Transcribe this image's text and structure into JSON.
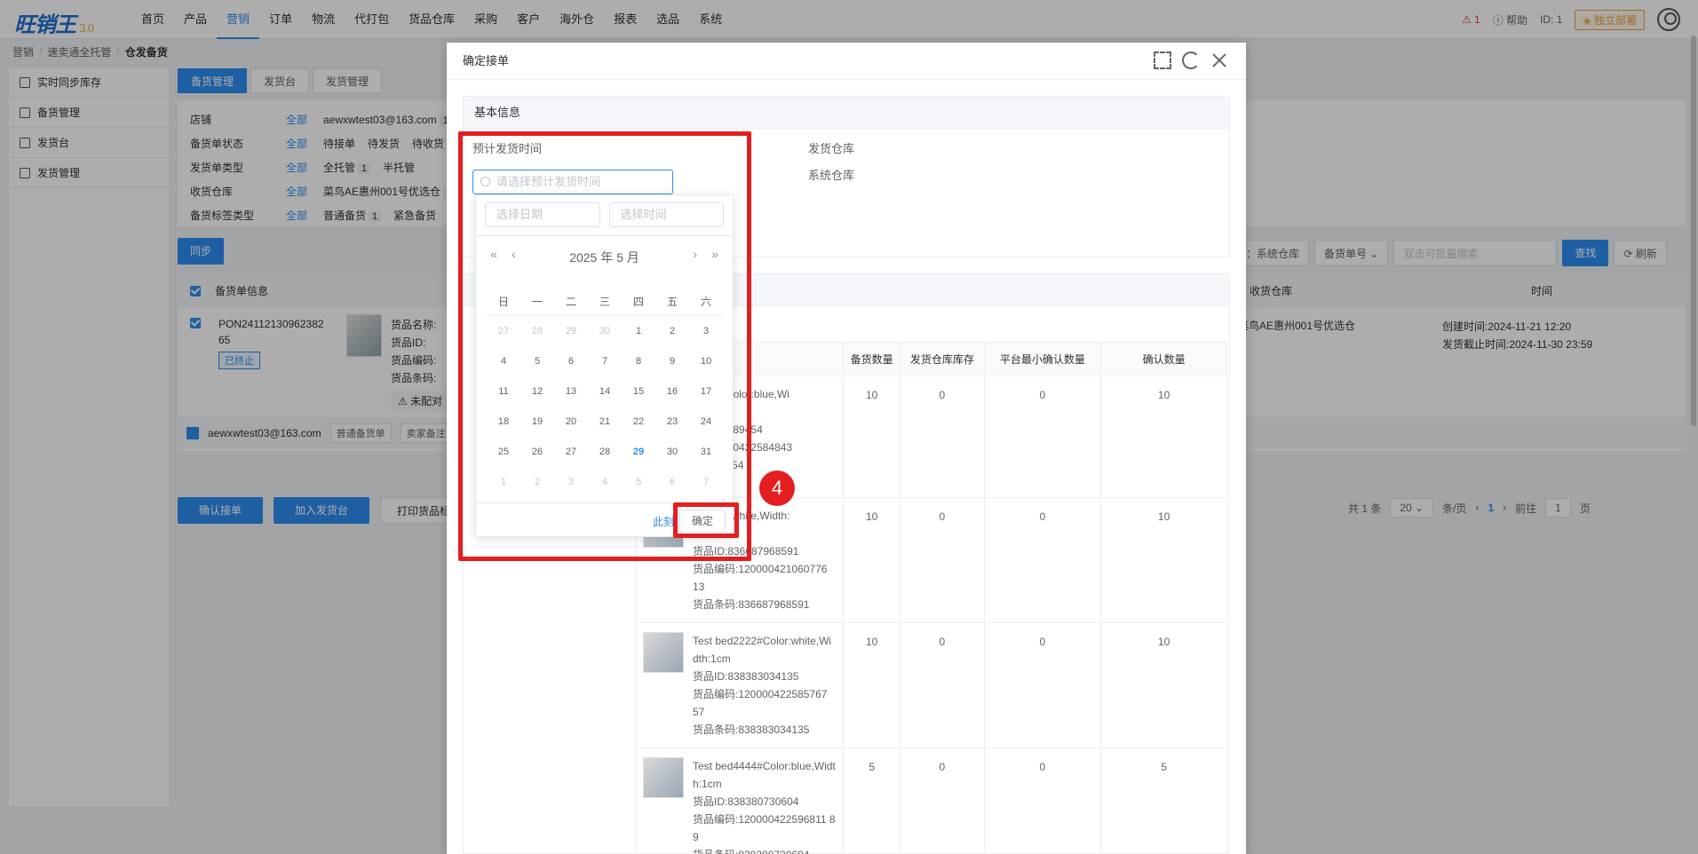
{
  "app": {
    "logo": "旺销王",
    "version": "3.0"
  },
  "topnav": {
    "items": [
      "首页",
      "产品",
      "营销",
      "订单",
      "物流",
      "代打包",
      "货品仓库",
      "采购",
      "客户",
      "海外仓",
      "报表",
      "选品",
      "系统"
    ],
    "active_index": 2,
    "warning_count": "1",
    "help_label": "帮助",
    "user_id": "ID: 1",
    "deploy_label": "独立部署"
  },
  "breadcrumb": [
    "营销",
    "速卖通全托管",
    "仓发备货"
  ],
  "sidebar": {
    "items": [
      "实时同步库存",
      "备货管理",
      "发货台",
      "发货管理"
    ]
  },
  "subtabs": [
    "备货管理",
    "发货台",
    "发货管理"
  ],
  "filters": {
    "rows": [
      {
        "label": "店铺",
        "all": "全部",
        "options": [
          "aewxwtest03@163.com"
        ],
        "counts": [
          "1"
        ]
      },
      {
        "label": "备货单状态",
        "all": "全部",
        "options": [
          "待接单",
          "待发货",
          "待收货"
        ],
        "counts": []
      },
      {
        "label": "发货单类型",
        "all": "全部",
        "options": [
          "全托管",
          "半托管"
        ],
        "counts": [
          "1"
        ]
      },
      {
        "label": "收货仓库",
        "all": "全部",
        "options": [
          "菜鸟AE惠州001号优选仓"
        ],
        "counts": [
          "1"
        ]
      },
      {
        "label": "备货标签类型",
        "all": "全部",
        "options": [
          "普通备货",
          "紧急备货"
        ],
        "counts": [
          "1"
        ]
      }
    ]
  },
  "sync_button": "同步",
  "search_tools": {
    "warehouse_filter": "库：系统仓库",
    "field_select": "备货单号",
    "search_placeholder": "双击可批量搜索",
    "search_button": "查找",
    "refresh_button": "刷新"
  },
  "main_table": {
    "headers": [
      "备货单信息",
      "收货仓库",
      "时间"
    ],
    "row": {
      "order_no": "PON2411213096238265",
      "status": "已终止",
      "goods_labels": [
        "货品名称:",
        "货品ID:",
        "货品编码:",
        "货品条码:"
      ],
      "unmatched": "未配对",
      "warehouse": "菜鸟AE惠州001号优选仓",
      "created": "创建时间:2024-11-21 12:20",
      "deadline": "发货截止时间:2024-11-30 23:59"
    },
    "shop_row": {
      "shop": "aewxwtest03@163.com",
      "tags": [
        "普通备货单",
        "卖家备注"
      ]
    }
  },
  "bottom_actions": [
    "确认接单",
    "加入发货台",
    "打印货品标签"
  ],
  "pager": {
    "total": "共 1 条",
    "page_size": "20",
    "per_page": "条/页",
    "current": "1",
    "goto": "前往",
    "goto_value": "1",
    "page_unit": "页"
  },
  "modal": {
    "title": "确定接单",
    "basic_info_title": "基本信息",
    "est_ship_label": "预计发货时间",
    "date_placeholder": "请选择预计发货时间",
    "ship_wh_label": "发货仓库",
    "sys_wh_label": "系统仓库",
    "goods_headers": [
      "",
      "备货数量",
      "发货仓库库存",
      "平台最小确认数量",
      "确认数量"
    ],
    "goods": [
      {
        "info": [
          "…111#Color:blue,Wi",
          "…",
          "…8621389454",
          "…120000422584843",
          "…838…54"
        ],
        "qty": "10",
        "stock": "0",
        "min": "0",
        "confirm": "10"
      },
      {
        "info": [
          "…Color:white,Width:",
          "…",
          "货品ID:836687968591",
          "货品编码:120000421060776 13",
          "货品条码:836687968591"
        ],
        "qty": "10",
        "stock": "0",
        "min": "0",
        "confirm": "10"
      },
      {
        "info": [
          "Test bed2222#Color:white,Width:1cm",
          "货品ID:838383034135",
          "货品编码:120000422585767 57",
          "货品条码:838383034135"
        ],
        "qty": "10",
        "stock": "0",
        "min": "0",
        "confirm": "10"
      },
      {
        "info": [
          "Test bed4444#Color:blue,Width:1cm",
          "货品ID:838380730604",
          "货品编码:120000422596811 89",
          "货品条码:838380730604"
        ],
        "qty": "5",
        "stock": "0",
        "min": "0",
        "confirm": "5"
      }
    ]
  },
  "datepicker": {
    "date_placeholder": "选择日期",
    "time_placeholder": "选择时间",
    "title": "2025 年  5 月",
    "weekdays": [
      "日",
      "一",
      "二",
      "三",
      "四",
      "五",
      "六"
    ],
    "days": [
      [
        "27",
        "m"
      ],
      [
        "28",
        "m"
      ],
      [
        "29",
        "m"
      ],
      [
        "30",
        "m"
      ],
      [
        "1",
        ""
      ],
      [
        "2",
        ""
      ],
      [
        "3",
        ""
      ],
      [
        "4",
        ""
      ],
      [
        "5",
        ""
      ],
      [
        "6",
        ""
      ],
      [
        "7",
        ""
      ],
      [
        "8",
        ""
      ],
      [
        "9",
        ""
      ],
      [
        "10",
        ""
      ],
      [
        "11",
        ""
      ],
      [
        "12",
        ""
      ],
      [
        "13",
        ""
      ],
      [
        "14",
        ""
      ],
      [
        "15",
        ""
      ],
      [
        "16",
        ""
      ],
      [
        "17",
        ""
      ],
      [
        "18",
        ""
      ],
      [
        "19",
        ""
      ],
      [
        "20",
        ""
      ],
      [
        "21",
        ""
      ],
      [
        "22",
        ""
      ],
      [
        "23",
        ""
      ],
      [
        "24",
        ""
      ],
      [
        "25",
        ""
      ],
      [
        "26",
        ""
      ],
      [
        "27",
        ""
      ],
      [
        "28",
        ""
      ],
      [
        "29",
        "t"
      ],
      [
        "30",
        ""
      ],
      [
        "31",
        ""
      ],
      [
        "1",
        "m"
      ],
      [
        "2",
        "m"
      ],
      [
        "3",
        "m"
      ],
      [
        "4",
        "m"
      ],
      [
        "5",
        "m"
      ],
      [
        "6",
        "m"
      ],
      [
        "7",
        "m"
      ]
    ],
    "now_label": "此刻",
    "ok_label": "确定"
  },
  "step_badge": "4"
}
